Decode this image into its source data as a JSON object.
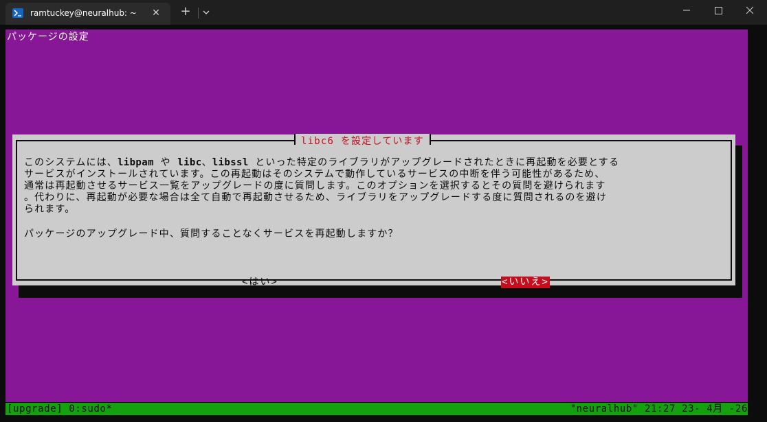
{
  "window": {
    "tab_title": "ramtuckey@neuralhub: ~",
    "tab_icon": "powershell-terminal-icon",
    "new_tab_label": "+",
    "close_glyph": "✕"
  },
  "terminal": {
    "top_title": "パッケージの設定",
    "background_color": "#881798",
    "dialog": {
      "title": "libc6 を設定しています",
      "lines": [
        [
          {
            "t": "このシステムには、"
          },
          {
            "t": "libpam",
            "b": true
          },
          {
            "t": " や "
          },
          {
            "t": "libc",
            "b": true
          },
          {
            "t": "、"
          },
          {
            "t": "libssl",
            "b": true
          },
          {
            "t": " といった特定のライブラリがアップグレードされたときに再起動を必要とする"
          }
        ],
        [
          {
            "t": "サービスがインストールされています。この再起動はそのシステムで動作しているサービスの中断を伴う可能性があるため、"
          }
        ],
        [
          {
            "t": "通常は再起動させるサービス一覧をアップグレードの度に質問します。このオプションを選択するとその質問を避けられます"
          }
        ],
        [
          {
            "t": "。代わりに、再起動が必要な場合は全て自動で再起動させるため、ライブラリをアップグレードする度に質問されるのを避け"
          }
        ],
        [
          {
            "t": "られます。"
          }
        ]
      ],
      "question": "パッケージのアップグレード中、質問することなくサービスを再起動しますか？",
      "yes_label": "<はい>",
      "no_label": "<いいえ>",
      "selected": "いいえ"
    },
    "status_bar": {
      "left": "[upgrade] 0:sudo*",
      "right": "\"neuralhub\" 21:27 23- 4月 -26"
    }
  }
}
